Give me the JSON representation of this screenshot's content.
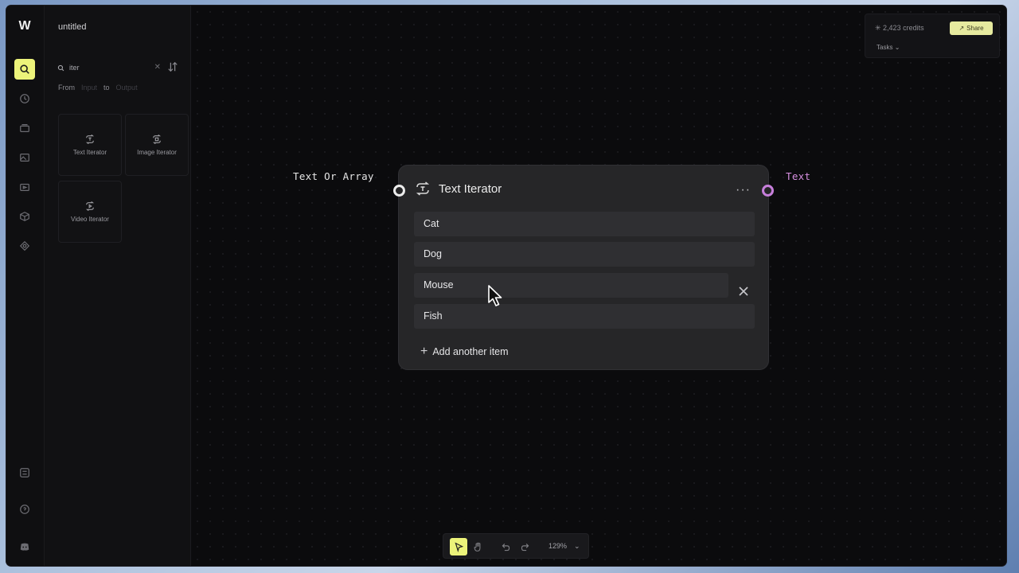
{
  "app": {
    "title": "untitled",
    "logo_text": "W"
  },
  "sidebar_search": {
    "value": "iter",
    "clear_glyph": "✕"
  },
  "filter": {
    "from_label": "From",
    "input_label": "Input",
    "to_label": "to",
    "output_label": "Output"
  },
  "tiles": [
    {
      "label": "Text Iterator",
      "icon": "iterator-icon"
    },
    {
      "label": "Image Iterator",
      "icon": "iterator-icon"
    },
    {
      "label": "Video Iterator",
      "icon": "iterator-icon"
    }
  ],
  "topright": {
    "credits": "2,423 credits",
    "share_label": "Share",
    "tasks_label": "Tasks"
  },
  "node": {
    "input_port_label": "Text Or Array",
    "output_port_label": "Text",
    "title": "Text Iterator",
    "menu_glyph": "···",
    "items": [
      "Cat",
      "Dog",
      "Mouse",
      "Fish"
    ],
    "add_label": "Add another item",
    "plus_glyph": "+"
  },
  "toolbar": {
    "zoom": "129%",
    "chevron": "⌄"
  },
  "colors": {
    "accent": "#ecf37a",
    "output_port": "#c77fdb",
    "node_bg": "#262628"
  }
}
